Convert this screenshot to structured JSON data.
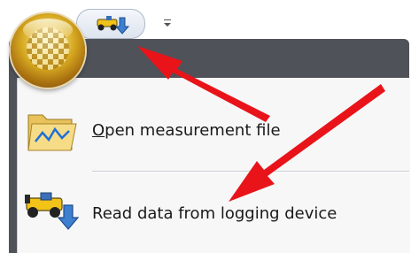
{
  "ribbon": {
    "app_button_icon": "checkered-flag-orb-icon",
    "quick_access": {
      "read_button_icon": "race-car-download-icon",
      "customize_icon": "dropdown-arrow-icon"
    }
  },
  "menu": {
    "items": [
      {
        "icon": "folder-chart-icon",
        "label_first": "O",
        "label_rest": "pen measurement file"
      },
      {
        "icon": "race-car-download-icon",
        "label": "Read data from logging device"
      }
    ]
  },
  "annotations": {
    "arrow_color": "#e8141a"
  },
  "colors": {
    "frame": "#4f5258",
    "panel": "#f7f7f7",
    "orb": "#d6a820"
  }
}
